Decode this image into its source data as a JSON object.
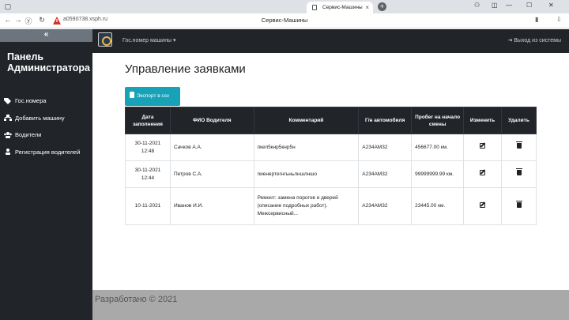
{
  "browser": {
    "tab_title": "Сервис-Машины",
    "page_title": "Сервис-Машины",
    "url": "a0590738.xsph.ru",
    "tab_close": "×",
    "new_tab": "+"
  },
  "sidebar": {
    "collapse_label": "«",
    "title": "Панель Администратора",
    "items": [
      {
        "label": "Гос.номера",
        "icon": "tags-icon"
      },
      {
        "label": "Добавить машину",
        "icon": "sitemap-icon"
      },
      {
        "label": "Водители",
        "icon": "users-icon"
      },
      {
        "label": "Регистрация водителей",
        "icon": "user-icon"
      }
    ]
  },
  "topbar": {
    "dropdown_label": "Гос.номер машины ▾",
    "logout_label": "⇥ Выход из системы"
  },
  "main": {
    "heading": "Управление заявками",
    "export_label": "Экспорт в csv"
  },
  "table": {
    "headers": [
      "Дата заполнения",
      "ФИО Водителя",
      "Комментарий",
      "Г/н автомобиля",
      "Пробег на начало смены",
      "Изменить",
      "Удалить"
    ],
    "rows": [
      {
        "date": "30-11-2021 12:48",
        "driver": "Сачков А.А.",
        "comment": "пкеп5кнр5кнр5н",
        "plate": "А234АМ32",
        "mileage": "456677.00 км."
      },
      {
        "date": "30-11-2021 12:44",
        "driver": "Петров С.А.",
        "comment": "пиенертегнгьньлншлншо",
        "plate": "А234АМ32",
        "mileage": "99999999.99 км."
      },
      {
        "date": "10-11-2021",
        "driver": "Иванов И.И.",
        "comment": "Ремонт: замена порогов и дверей (описание подробных работ). Межсервисный...",
        "plate": "А234АМ32",
        "mileage": "23445.00 км."
      }
    ]
  },
  "footer": {
    "text": "Разработано © 2021"
  },
  "colors": {
    "sidebar_bg": "#212529",
    "export_button": "#17a2b8",
    "footer_bg": "#a9a9a9"
  }
}
